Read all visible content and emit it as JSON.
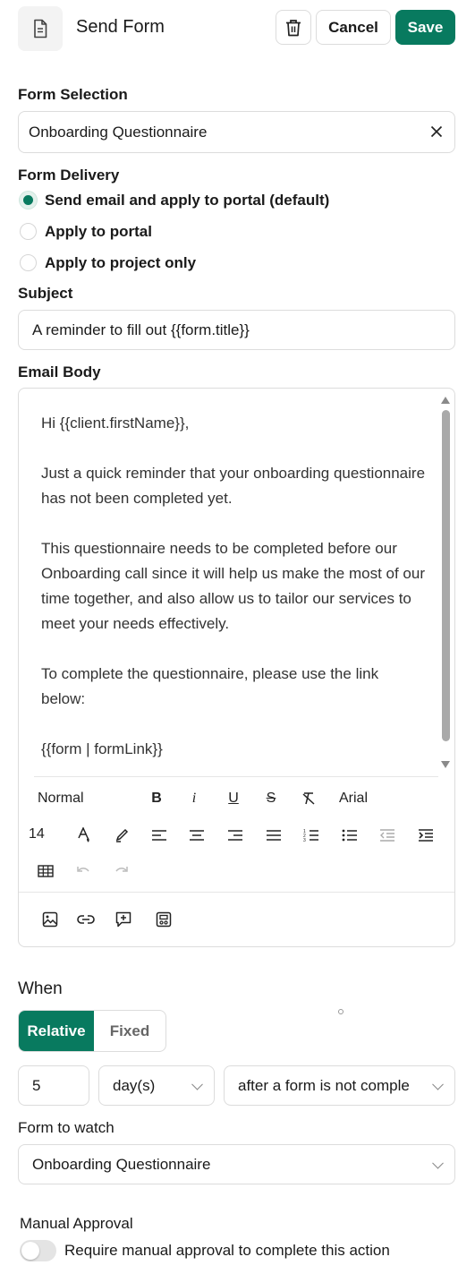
{
  "header": {
    "title": "Send Form",
    "cancel_label": "Cancel",
    "save_label": "Save",
    "icons": {
      "doc": "document-icon",
      "delete": "trash-icon"
    }
  },
  "form_selection": {
    "label": "Form Selection",
    "value": "Onboarding Questionnaire"
  },
  "form_delivery": {
    "label": "Form Delivery",
    "options": [
      {
        "label": "Send email and apply to portal (default)",
        "selected": true
      },
      {
        "label": "Apply to portal",
        "selected": false
      },
      {
        "label": "Apply to project only",
        "selected": false
      }
    ]
  },
  "subject": {
    "label": "Subject",
    "value": "A reminder to fill out {{form.title}}"
  },
  "email_body": {
    "label": "Email Body",
    "paragraphs": [
      "Hi {{client.firstName}},",
      "Just a quick reminder that your onboarding questionnaire has not been completed yet.",
      "This questionnaire needs to be completed before our Onboarding call since it will help us make the most of our time together, and also allow us to tailor our services to meet your needs effectively.",
      "To complete the questionnaire, please use the link below:",
      "{{form | formLink}}"
    ],
    "toolbar": {
      "style_select": "Normal",
      "font_select": "Arial",
      "size_select": "14"
    }
  },
  "when": {
    "label": "When",
    "tabs": [
      "Relative",
      "Fixed"
    ],
    "active_tab": "Relative",
    "amount": "5",
    "unit": "day(s)",
    "trigger": "after a form is not comple"
  },
  "form_to_watch": {
    "label": "Form to watch",
    "value": "Onboarding Questionnaire"
  },
  "manual_approval": {
    "label": "Manual Approval",
    "toggle_label": "Require manual approval to complete this action",
    "enabled": false
  },
  "colors": {
    "accent": "#087a5f",
    "border": "#dcdcdc"
  }
}
